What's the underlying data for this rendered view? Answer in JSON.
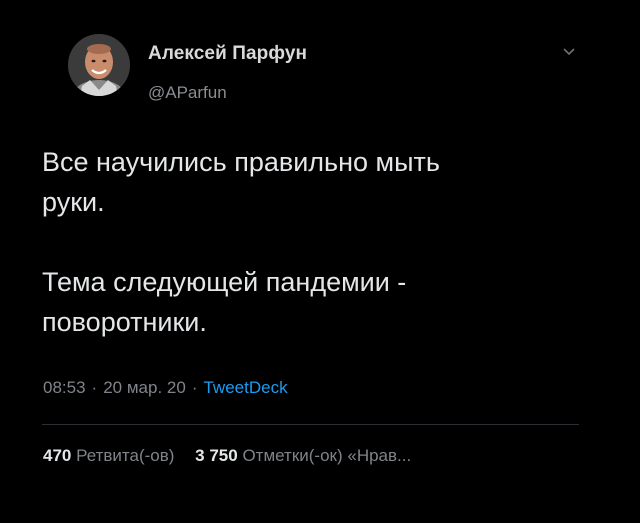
{
  "tweet": {
    "author": {
      "name": "Алексей Парфун",
      "handle": "@AParfun",
      "avatar_icon": "user-avatar-photo"
    },
    "menu_icon": "chevron-down-icon",
    "text": "Все научились правильно мыть\nруки.\n\nТема следующей пандемии -\nповоротники.",
    "meta": {
      "time": "08:53",
      "date": "20 мар. 20",
      "separator": "·",
      "source": "TweetDeck"
    },
    "stats": {
      "retweets_count": "470",
      "retweets_label": "Ретвита(-ов)",
      "likes_count": "3 750",
      "likes_label": "Отметки(-ок) «Нрав..."
    }
  },
  "colors": {
    "background": "#000000",
    "text": "#e4e6e8",
    "secondary": "#80848a",
    "link": "#1d9bf0"
  }
}
